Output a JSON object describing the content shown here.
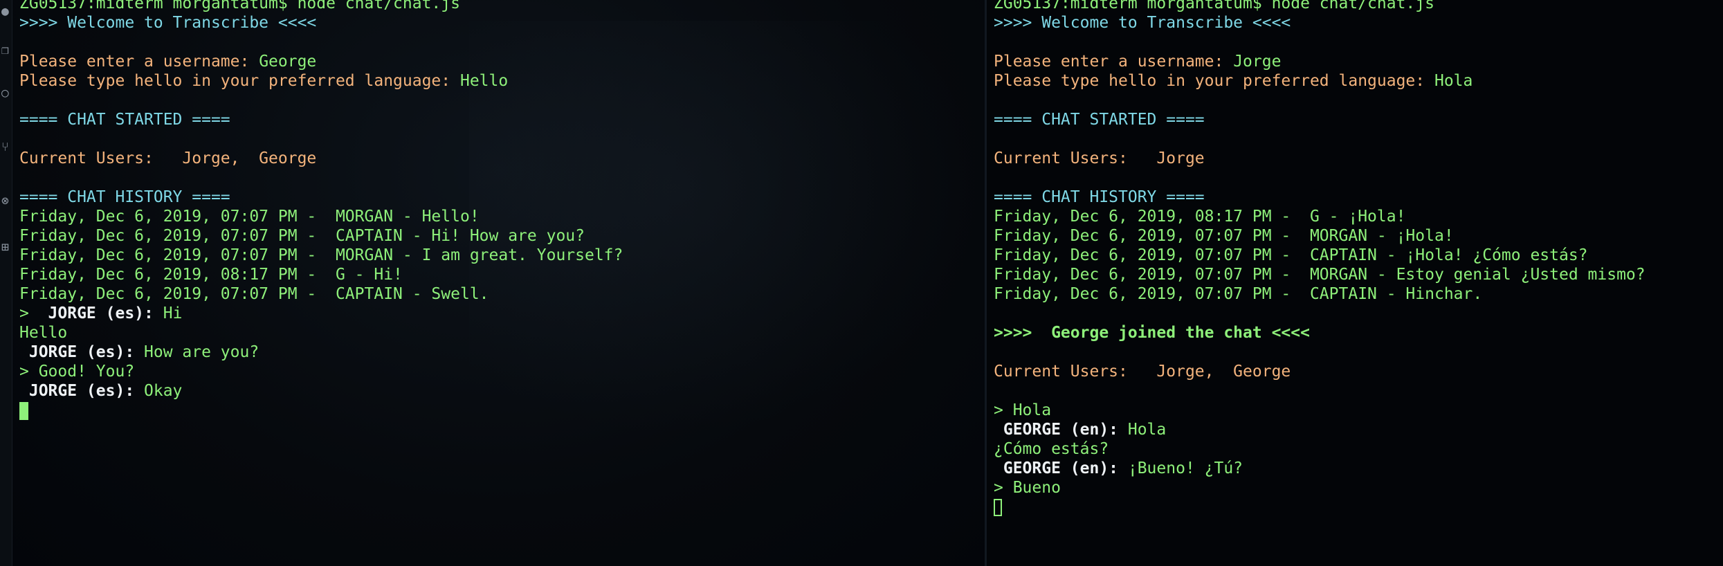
{
  "left_terminal": {
    "prompt_line": "ZG05137:midterm morgantatum$ node chat/chat.js",
    "welcome": ">>>> Welcome to Transcribe <<<<",
    "username_prompt": "Please enter a username: ",
    "username_value": "George",
    "hello_prompt": "Please type hello in your preferred language: ",
    "hello_value": "Hello",
    "chat_started": "==== CHAT STARTED ====",
    "current_users_label": "Current Users:  ",
    "current_users_value": " Jorge,  George",
    "history_header": "==== CHAT HISTORY ====",
    "history": [
      "Friday, Dec 6, 2019, 07:07 PM -  MORGAN - Hello!",
      "Friday, Dec 6, 2019, 07:07 PM -  CAPTAIN - Hi! How are you?",
      "Friday, Dec 6, 2019, 07:07 PM -  MORGAN - I am great. Yourself?",
      "Friday, Dec 6, 2019, 08:17 PM -  G - Hi!",
      "Friday, Dec 6, 2019, 07:07 PM -  CAPTAIN - Swell."
    ],
    "msg1_prefix": ">  ",
    "msg1_sender": "JORGE (es):",
    "msg1_text": " Hi",
    "sent1": "Hello",
    "msg2_sender": " JORGE (es):",
    "msg2_text": " How are you?",
    "sent2": "> Good! You?",
    "msg3_sender": " JORGE (es):",
    "msg3_text": " Okay"
  },
  "right_terminal": {
    "prompt_line": "ZG05137:midterm morgantatum$ node chat/chat.js",
    "welcome": ">>>> Welcome to Transcribe <<<<",
    "username_prompt": "Please enter a username: ",
    "username_value": "Jorge",
    "hello_prompt": "Please type hello in your preferred language: ",
    "hello_value": "Hola",
    "chat_started": "==== CHAT STARTED ====",
    "current_users_label": "Current Users:  ",
    "current_users_value": " Jorge",
    "history_header": "==== CHAT HISTORY ====",
    "history": [
      "Friday, Dec 6, 2019, 08:17 PM -  G - ¡Hola!",
      "Friday, Dec 6, 2019, 07:07 PM -  MORGAN - ¡Hola!",
      "Friday, Dec 6, 2019, 07:07 PM -  CAPTAIN - ¡Hola! ¿Cómo estás?",
      "Friday, Dec 6, 2019, 07:07 PM -  MORGAN - Estoy genial ¿Usted mismo?",
      "Friday, Dec 6, 2019, 07:07 PM -  CAPTAIN - Hinchar."
    ],
    "join_notice": ">>>>  George joined the chat <<<<",
    "current_users_label_2": "Current Users:  ",
    "current_users_value_2": " Jorge,  George",
    "sent1": "> Hola",
    "msg1_sender": " GEORGE (en):",
    "msg1_text": " Hola",
    "sent2": "¿Cómo estás?",
    "msg2_sender": " GEORGE (en):",
    "msg2_text": " ¡Bueno! ¿Tú?",
    "sent3": "> Bueno"
  }
}
